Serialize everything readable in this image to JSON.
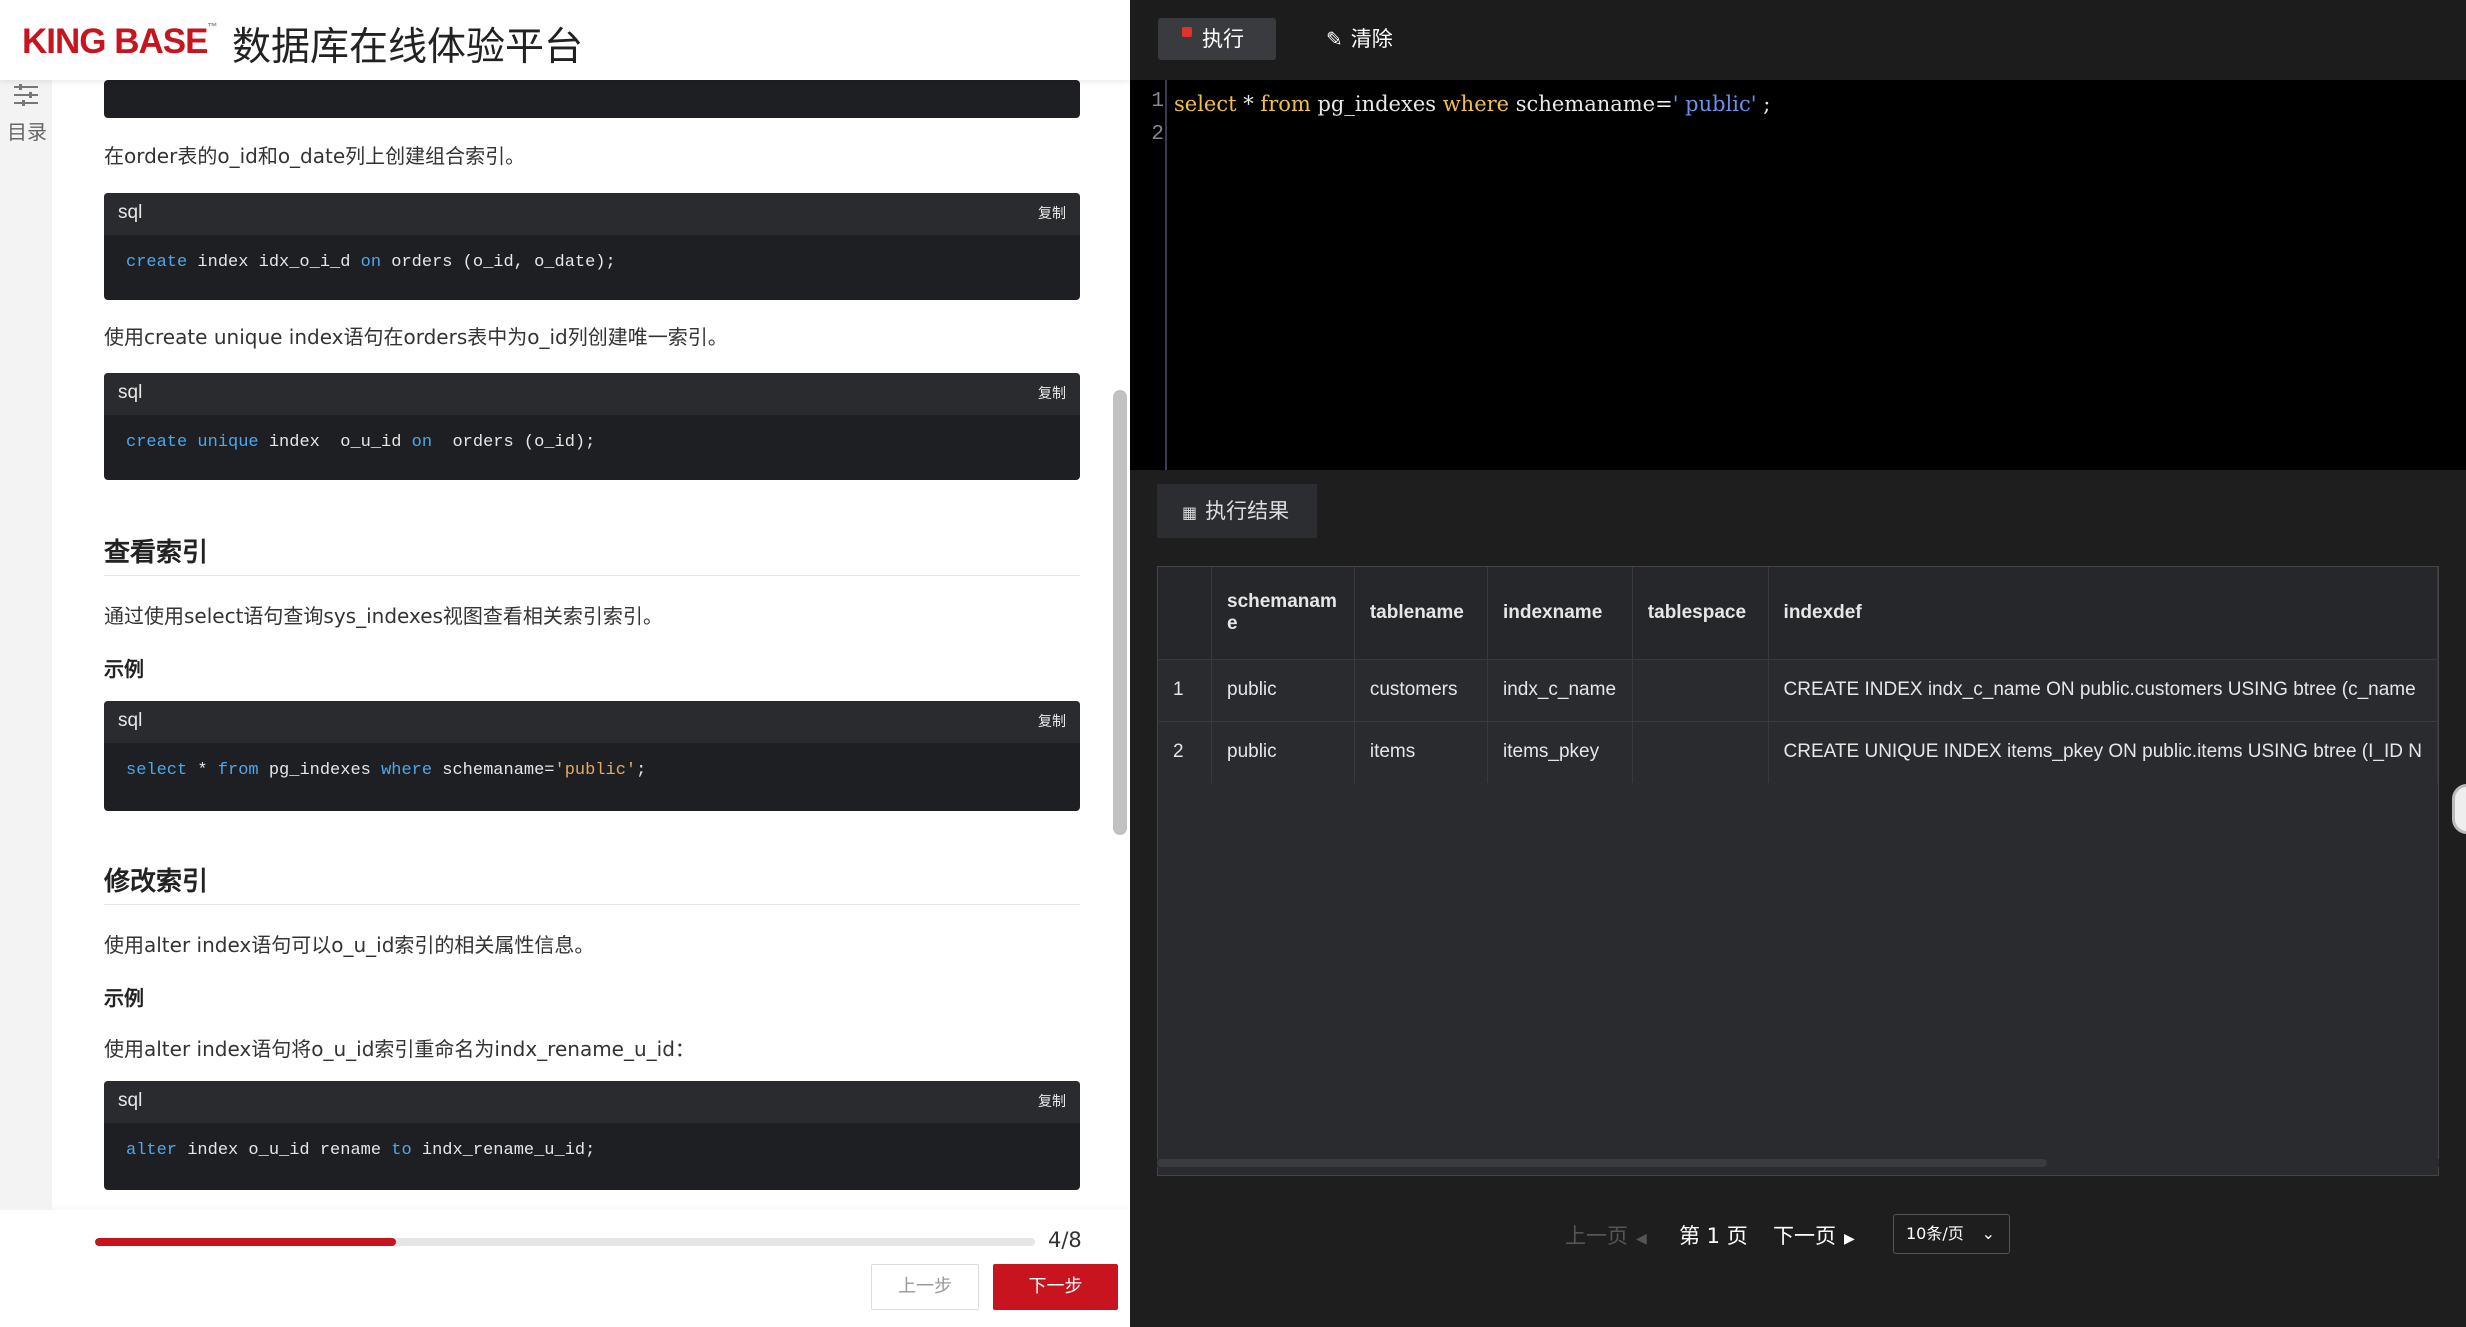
{
  "header": {
    "logo_text": "KING BASE",
    "logo_tm": "™",
    "title": "数据库在线体验平台"
  },
  "toc": {
    "label": "目录",
    "icon": "sliders-icon"
  },
  "doc": {
    "intro_composite": "在order表的o_id和o_date列上创建组合索引。",
    "code1": {
      "lang": "sql",
      "copy": "复制",
      "c1": "create",
      "c2": " index idx_o_i_d ",
      "c3": "on",
      "c4": " orders (o_id, o_date);"
    },
    "unique_desc": "使用create unique index语句在orders表中为o_id列创建唯一索引。",
    "code2": {
      "lang": "sql",
      "copy": "复制",
      "c1": "create",
      "c2": " ",
      "c3": "unique",
      "c4": " index  o_u_id ",
      "c5": "on",
      "c6": "  orders (o_id);"
    },
    "view_heading": "查看索引",
    "view_desc": "通过使用select语句查询sys_indexes视图查看相关索引索引。",
    "example1": "示例",
    "code3": {
      "lang": "sql",
      "copy": "复制",
      "c1": "select",
      "c2": " * ",
      "c3": "from",
      "c4": " pg_indexes ",
      "c5": "where",
      "c6": " schemaname=",
      "c7": "'public'",
      "c8": ";"
    },
    "alter_heading": "修改索引",
    "alter_desc": "使用alter index语句可以o_u_id索引的相关属性信息。",
    "example2": "示例",
    "rename_desc": "使用alter index语句将o_u_id索引重命名为indx_rename_u_id：",
    "code4": {
      "lang": "sql",
      "copy": "复制",
      "c1": "alter",
      "c2": " index o_u_id rename ",
      "c3": "to",
      "c4": " indx_rename_u_id;"
    }
  },
  "footer": {
    "progress_text": "4/8",
    "progress_fraction": 0.32,
    "prev_label": "上一步",
    "next_label": "下一步"
  },
  "toolbar": {
    "run_label": "执行",
    "clear_label": "清除"
  },
  "editor": {
    "lines": [
      "1",
      "2"
    ],
    "t1": "select",
    "t2": " * ",
    "t3": "from",
    "t4": " pg_indexes ",
    "t5": "where",
    "t6": " schemaname=",
    "t7": "' public'",
    "t8": " ;"
  },
  "result": {
    "tab_label": "执行结果",
    "columns": [
      "schemanam\ne",
      "tablename",
      "indexname",
      "tablespace",
      "indexdef"
    ],
    "rows": [
      [
        "1",
        "public",
        "customers",
        "indx_c_name",
        "",
        "CREATE INDEX indx_c_name ON public.customers USING btree (c_name"
      ],
      [
        "2",
        "public",
        "items",
        "items_pkey",
        "",
        "CREATE UNIQUE INDEX items_pkey ON public.items USING btree (I_ID N"
      ]
    ]
  },
  "pagination": {
    "prev_label": "上一页",
    "current_label": "第 1 页",
    "next_label": "下一页",
    "page_size": "10条/页"
  },
  "colors": {
    "brand_red": "#c8141e",
    "keyword_blue": "#4ea7ea",
    "editor_keyword": "#f3c043",
    "editor_string": "#6c8fe8"
  }
}
